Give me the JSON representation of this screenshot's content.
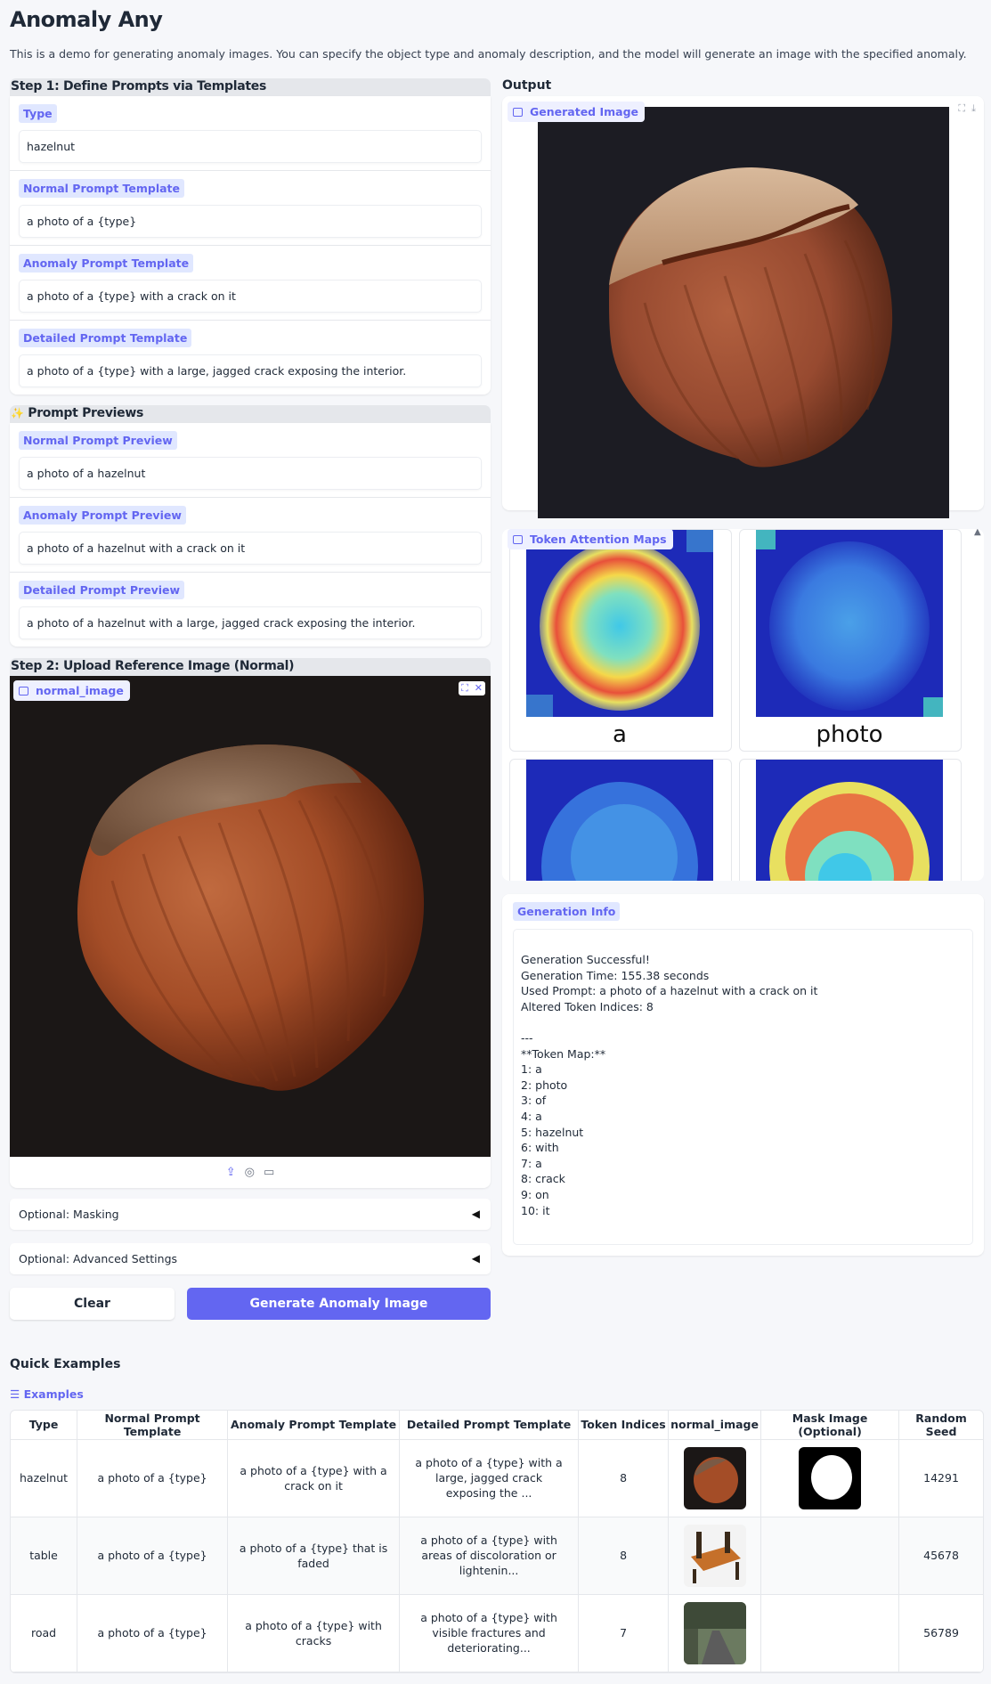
{
  "app": {
    "title": "Anomaly Any",
    "description": "This is a demo for generating anomaly images. You can specify the object type and anomaly description, and the model will generate an image with the specified anomaly."
  },
  "step1": {
    "heading": "Step 1: Define Prompts via Templates",
    "fields": [
      {
        "label": "Type",
        "value": "hazelnut"
      },
      {
        "label": "Normal Prompt Template",
        "value": "a photo of a {type}"
      },
      {
        "label": "Anomaly Prompt Template",
        "value": "a photo of a {type} with a crack on it"
      },
      {
        "label": "Detailed Prompt Template",
        "value": "a photo of a {type} with a large, jagged crack exposing the interior."
      }
    ]
  },
  "previews": {
    "icon": "sparkles-icon",
    "heading": "Prompt Previews",
    "fields": [
      {
        "label": "Normal Prompt Preview",
        "value": "a photo of a hazelnut"
      },
      {
        "label": "Anomaly Prompt Preview",
        "value": "a photo of a hazelnut with a crack on it"
      },
      {
        "label": "Detailed Prompt Preview",
        "value": "a photo of a hazelnut with a large, jagged crack exposing the interior."
      }
    ]
  },
  "step2": {
    "heading": "Step 2: Upload Reference Image (Normal)",
    "image_label": "normal_image"
  },
  "accordions": {
    "masking": "Optional: Masking",
    "advanced": "Optional: Advanced Settings"
  },
  "buttons": {
    "clear": "Clear",
    "generate": "Generate Anomaly Image"
  },
  "output": {
    "heading": "Output",
    "generated_label": "Generated Image",
    "attention_label": "Token Attention Maps",
    "attention_captions": [
      "a",
      "photo"
    ],
    "info_label": "Generation Info",
    "info_text": "Generation Successful!\nGeneration Time: 155.38 seconds\nUsed Prompt: a photo of a hazelnut with a crack on it\nAltered Token Indices: 8\n\n---\n**Token Map:**\n1: a\n2: photo\n3: of\n4: a\n5: hazelnut\n6: with\n7: a\n8: crack\n9: on\n10: it"
  },
  "examples": {
    "heading": "Quick Examples",
    "tag": "Examples",
    "columns": [
      "Type",
      "Normal Prompt Template",
      "Anomaly Prompt Template",
      "Detailed Prompt Template",
      "Token Indices",
      "normal_image",
      "Mask Image (Optional)",
      "Random Seed"
    ],
    "rows": [
      {
        "type": "hazelnut",
        "normal": "a photo of a {type}",
        "anomaly": "a photo of a {type} with a crack on it",
        "detailed": "a photo of a {type} with a large, jagged crack exposing the ...",
        "indices": "8",
        "seed": "14291"
      },
      {
        "type": "table",
        "normal": "a photo of a {type}",
        "anomaly": "a photo of a {type} that is faded",
        "detailed": "a photo of a {type} with areas of discoloration or lightenin...",
        "indices": "8",
        "seed": "45678"
      },
      {
        "type": "road",
        "normal": "a photo of a {type}",
        "anomaly": "a photo of a {type} with cracks",
        "detailed": "a photo of a {type} with visible fractures and deteriorating...",
        "indices": "7",
        "seed": "56789"
      }
    ]
  },
  "colors": {
    "accent": "#6366f1",
    "tag_bg": "#e0e7ff",
    "background": "#f6f7fa"
  }
}
